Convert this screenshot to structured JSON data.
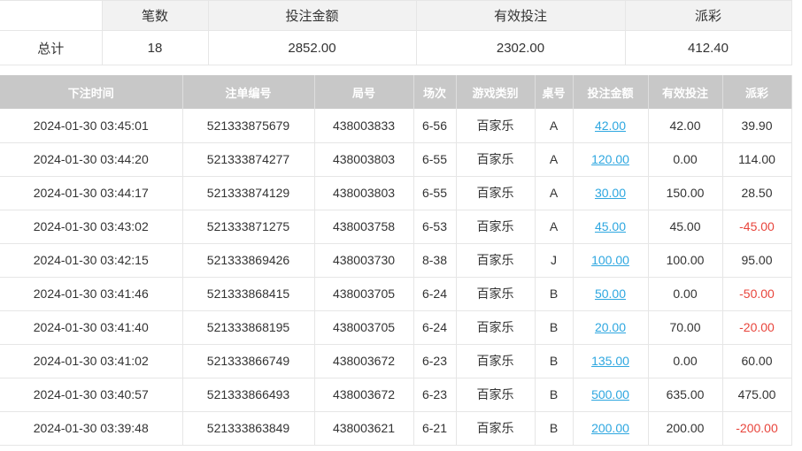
{
  "summary": {
    "headers": [
      "",
      "笔数",
      "投注金额",
      "有效投注",
      "派彩"
    ],
    "row": [
      "总计",
      "18",
      "2852.00",
      "2302.00",
      "412.40"
    ]
  },
  "detail": {
    "headers": [
      "下注时间",
      "注单编号",
      "局号",
      "场次",
      "游戏类别",
      "桌号",
      "投注金额",
      "有效投注",
      "派彩"
    ],
    "rows": [
      {
        "time": "2024-01-30 03:45:01",
        "order": "521333875679",
        "round": "438003833",
        "session": "6-56",
        "game": "百家乐",
        "table": "A",
        "bet": "42.00",
        "valid": "42.00",
        "payout": "39.90",
        "neg": false
      },
      {
        "time": "2024-01-30 03:44:20",
        "order": "521333874277",
        "round": "438003803",
        "session": "6-55",
        "game": "百家乐",
        "table": "A",
        "bet": "120.00",
        "valid": "0.00",
        "payout": "114.00",
        "neg": false
      },
      {
        "time": "2024-01-30 03:44:17",
        "order": "521333874129",
        "round": "438003803",
        "session": "6-55",
        "game": "百家乐",
        "table": "A",
        "bet": "30.00",
        "valid": "150.00",
        "payout": "28.50",
        "neg": false
      },
      {
        "time": "2024-01-30 03:43:02",
        "order": "521333871275",
        "round": "438003758",
        "session": "6-53",
        "game": "百家乐",
        "table": "A",
        "bet": "45.00",
        "valid": "45.00",
        "payout": "-45.00",
        "neg": true
      },
      {
        "time": "2024-01-30 03:42:15",
        "order": "521333869426",
        "round": "438003730",
        "session": "8-38",
        "game": "百家乐",
        "table": "J",
        "bet": "100.00",
        "valid": "100.00",
        "payout": "95.00",
        "neg": false
      },
      {
        "time": "2024-01-30 03:41:46",
        "order": "521333868415",
        "round": "438003705",
        "session": "6-24",
        "game": "百家乐",
        "table": "B",
        "bet": "50.00",
        "valid": "0.00",
        "payout": "-50.00",
        "neg": true
      },
      {
        "time": "2024-01-30 03:41:40",
        "order": "521333868195",
        "round": "438003705",
        "session": "6-24",
        "game": "百家乐",
        "table": "B",
        "bet": "20.00",
        "valid": "70.00",
        "payout": "-20.00",
        "neg": true
      },
      {
        "time": "2024-01-30 03:41:02",
        "order": "521333866749",
        "round": "438003672",
        "session": "6-23",
        "game": "百家乐",
        "table": "B",
        "bet": "135.00",
        "valid": "0.00",
        "payout": "60.00",
        "neg": false
      },
      {
        "time": "2024-01-30 03:40:57",
        "order": "521333866493",
        "round": "438003672",
        "session": "6-23",
        "game": "百家乐",
        "table": "B",
        "bet": "500.00",
        "valid": "635.00",
        "payout": "475.00",
        "neg": false
      },
      {
        "time": "2024-01-30 03:39:48",
        "order": "521333863849",
        "round": "438003621",
        "session": "6-21",
        "game": "百家乐",
        "table": "B",
        "bet": "200.00",
        "valid": "200.00",
        "payout": "-200.00",
        "neg": true
      }
    ]
  }
}
